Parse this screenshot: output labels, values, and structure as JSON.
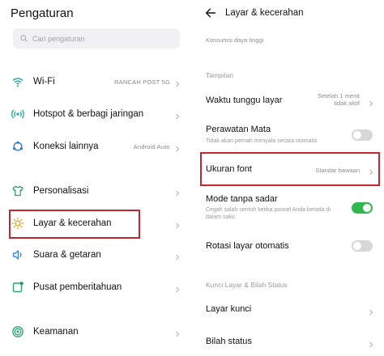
{
  "left": {
    "title": "Pengaturan",
    "search_placeholder": "Cari pengaturan",
    "items": [
      {
        "label": "Wi-Fi",
        "value": "RANCAH POST 5G",
        "icon": "wifi-icon"
      },
      {
        "label": "Hotspot & berbagi jaringan",
        "value": "",
        "icon": "hotspot-icon"
      },
      {
        "label": "Koneksi lainnya",
        "value": "Android Auto",
        "icon": "connection-icon"
      },
      {
        "label": "Personalisasi",
        "value": "",
        "icon": "tshirt-icon"
      },
      {
        "label": "Layar & kecerahan",
        "value": "",
        "icon": "brightness-icon"
      },
      {
        "label": "Suara & getaran",
        "value": "",
        "icon": "speaker-icon"
      },
      {
        "label": "Pusat pemberitahuan",
        "value": "",
        "icon": "notification-icon"
      },
      {
        "label": "Keamanan",
        "value": "",
        "icon": "security-icon"
      }
    ]
  },
  "right": {
    "title": "Layar & kecerahan",
    "top_cut_text": "Konsumsi daya tinggi",
    "section_tampilan": "Tampilan",
    "waktu_label": "Waktu tunggu layar",
    "waktu_value_line1": "Setelah 1 menit",
    "waktu_value_line2": "tidak aktif",
    "perawatan_label": "Perawatan Mata",
    "perawatan_desc": "Tidak akan pernah menyala secara otomatis",
    "ukuran_label": "Ukuran font",
    "ukuran_value": "Standar bawaan",
    "mode_label": "Mode tanpa sadar",
    "mode_desc": "Cegah salah sentuh ketika ponsel Anda berada di dalam saku",
    "rotasi_label": "Rotasi layar otomatis",
    "section_kunci": "Kunci Layar & Bilah Status",
    "layar_kunci_label": "Layar kunci",
    "bilah_status_label": "Bilah status",
    "toggles": {
      "perawatan_mata": false,
      "mode_tanpa_sadar": true,
      "rotasi_layar": false
    }
  },
  "colors": {
    "accent_green": "#2fb84f",
    "highlight_red": "#c0282c",
    "icon_teal": "#1ca6a6"
  }
}
